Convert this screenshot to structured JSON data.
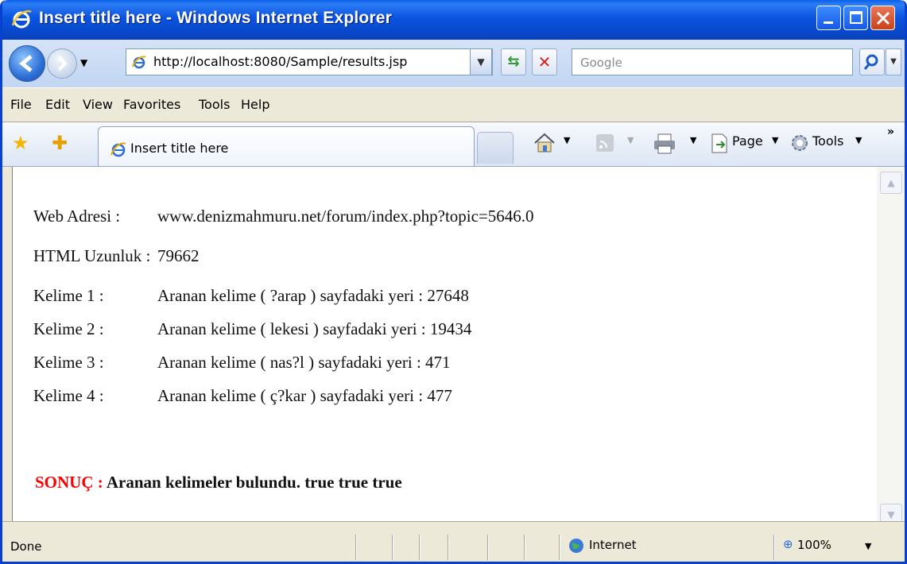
{
  "window": {
    "title": "Insert title here - Windows Internet Explorer"
  },
  "address": {
    "url": "http://localhost:8080/Sample/results.jsp",
    "search_placeholder": "Google"
  },
  "menu": [
    "File",
    "Edit",
    "View",
    "Favorites",
    "Tools",
    "Help"
  ],
  "tab": {
    "label": "Insert title here"
  },
  "command_bar": {
    "page_label": "Page",
    "tools_label": "Tools"
  },
  "content": {
    "rows": [
      {
        "label": "Web Adresi :",
        "value": "www.denizmahmuru.net/forum/index.php?topic=5646.0"
      },
      {
        "label": "HTML Uzunluk :",
        "value": "79662"
      },
      {
        "label": "Kelime 1 :",
        "value": "Aranan kelime ( ?arap ) sayfadaki yeri : 27648"
      },
      {
        "label": "Kelime 2 :",
        "value": "Aranan kelime ( lekesi ) sayfadaki yeri : 19434"
      },
      {
        "label": "Kelime 3 :",
        "value": "Aranan kelime ( nas?l ) sayfadaki yeri : 471"
      },
      {
        "label": "Kelime 4 :",
        "value": "Aranan kelime ( ç?kar ) sayfadaki yeri : 477"
      }
    ],
    "result_key": "SONUÇ :",
    "result_text": "Aranan kelimeler bulundu. true true true"
  },
  "status": {
    "text": "Done",
    "zone": "Internet",
    "zoom": "100%"
  },
  "colors": {
    "titlebar": "#0A53DF",
    "result_key": "#FF0000"
  }
}
